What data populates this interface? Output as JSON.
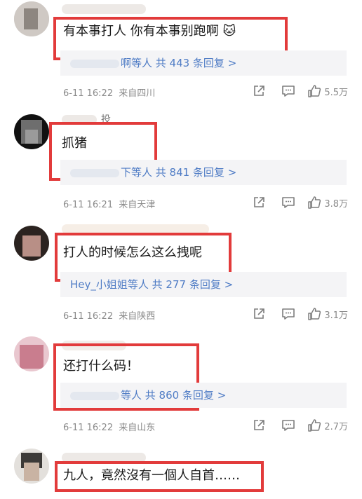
{
  "comments": [
    {
      "text": "有本事打人 你有本事别跑啊",
      "emoji": "🐱",
      "replies": {
        "suffix": "啊等人  共 443 条回复 >"
      },
      "time": "6-11 16:22",
      "location": "来自四川",
      "likes": "5.5万"
    },
    {
      "text": "抓猪",
      "username_fragment": "投",
      "replies": {
        "suffix": "下等人  共 841 条回复 >"
      },
      "time": "6-11 16:21",
      "location": "来自天津",
      "likes": "3.8万"
    },
    {
      "text": "打人的时候怎么这么拽呢",
      "replies": {
        "suffix": "Hey_小姐姐等人  共 277 条回复 >"
      },
      "time": "6-11 16:22",
      "location": "来自陕西",
      "likes": "3.1万"
    },
    {
      "text": "还打什么码！",
      "replies": {
        "suffix": "等人  共 860 条回复 >"
      },
      "time": "6-11 16:22",
      "location": "来自山东",
      "likes": "2.7万"
    },
    {
      "text": "九人，竟然沒有一個人自首……"
    }
  ],
  "icons": {
    "share": "share-icon",
    "comment": "comment-icon",
    "like": "thumbs-up-icon"
  },
  "colors": {
    "highlight_box": "#e23b3b",
    "link": "#4f7cc5",
    "meta": "#8a8a8a"
  }
}
